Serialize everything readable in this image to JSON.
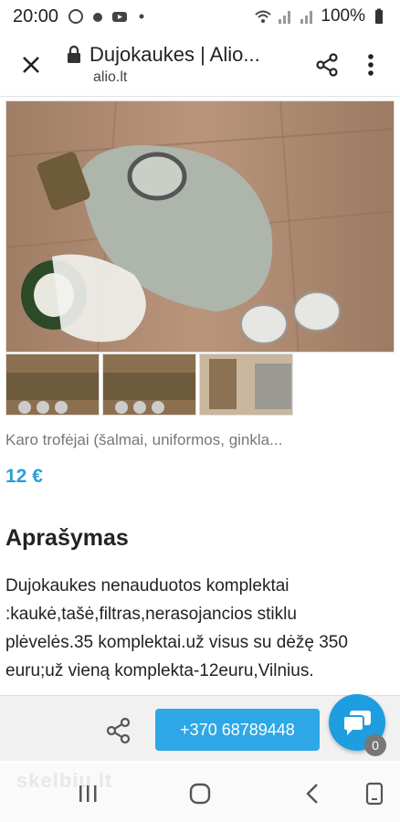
{
  "status_bar": {
    "time": "20:00",
    "battery": "100%"
  },
  "toolbar": {
    "title": "Dujokaukes | Alio...",
    "url": "alio.lt"
  },
  "listing": {
    "category": "Karo trofėjai (šalmai, uniformos, ginkla...",
    "price": "12 €",
    "description_title": "Aprašymas",
    "description": "Dujokaukes nenauduotos komplektai :kaukė,tašė,filtras,nerasojancios stiklu plėvelės.35 komplektai.už visus su dėžę 350 euru;už vieną komplekta-12euru,Vilnius."
  },
  "actions": {
    "phone": "+370 68789448",
    "chat_count": "0"
  },
  "watermark": "skelbiu.lt",
  "colors": {
    "accent": "#2ea7e6",
    "price": "#2a9fd8"
  }
}
